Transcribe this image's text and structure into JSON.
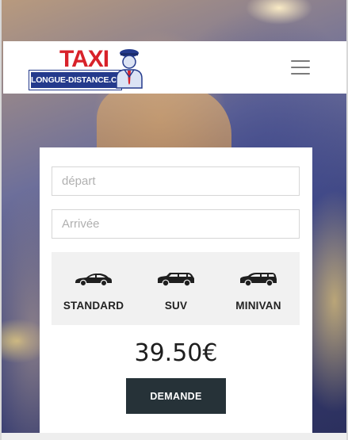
{
  "header": {
    "logo": {
      "word": "TAXI",
      "tagline": "LONGUE-DISTANCE.COM"
    },
    "menu_icon": "hamburger-menu-icon"
  },
  "form": {
    "depart": {
      "placeholder": "départ",
      "value": ""
    },
    "arrivee": {
      "placeholder": "Arrivée",
      "value": ""
    },
    "vehicles": [
      {
        "label": "STANDARD",
        "icon": "sedan-car-icon"
      },
      {
        "label": "SUV",
        "icon": "suv-car-icon"
      },
      {
        "label": "MINIVAN",
        "icon": "minivan-car-icon"
      }
    ],
    "price": "39.50€",
    "submit_label": "DEMANDE"
  },
  "colors": {
    "brand_red": "#d8222a",
    "brand_blue": "#243a8c",
    "button_dark": "#263238",
    "vehicle_panel": "#f1f1f1"
  }
}
